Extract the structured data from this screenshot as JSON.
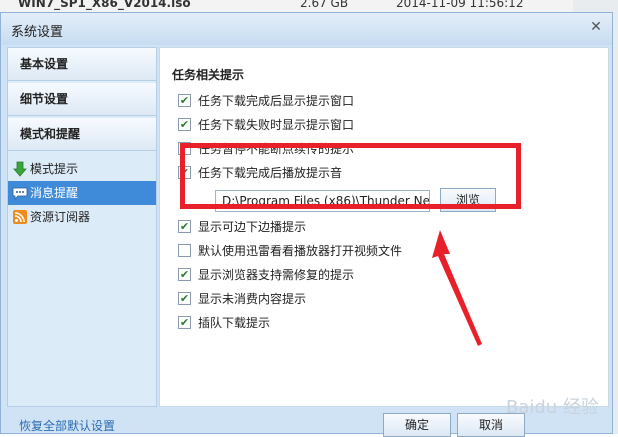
{
  "background": {
    "file_name": "WIN7_SP1_X86_V2014.iso",
    "file_size": "2.67 GB",
    "file_date": "2014-11-09 11:56:12"
  },
  "window": {
    "title": "系统设置",
    "close_glyph": "✕"
  },
  "sidebar": {
    "categories": [
      {
        "label": "基本设置"
      },
      {
        "label": "细节设置"
      },
      {
        "label": "模式和提醒"
      }
    ],
    "items": [
      {
        "label": "模式提示",
        "icon": "green-arrow-down-icon",
        "active": false
      },
      {
        "label": "消息提醒",
        "icon": "message-icon",
        "active": true
      },
      {
        "label": "资源订阅器",
        "icon": "rss-icon",
        "active": false
      }
    ]
  },
  "main": {
    "section_title": "任务相关提示",
    "options": [
      {
        "label": "任务下载完成后显示提示窗口",
        "checked": true
      },
      {
        "label": "任务下载失败时显示提示窗口",
        "checked": true
      },
      {
        "label": "任务暂停不能断点续传的提示",
        "checked": true
      },
      {
        "label": "任务下载完成后播放提示音",
        "checked": true
      },
      {
        "label": "显示可边下边播提示",
        "checked": true
      },
      {
        "label": "默认使用迅雷看看播放器打开视频文件",
        "checked": false
      },
      {
        "label": "显示浏览器支持需修复的提示",
        "checked": true
      },
      {
        "label": "显示未消费内容提示",
        "checked": true
      },
      {
        "label": "插队下载提示",
        "checked": true
      }
    ],
    "sound_path": "D:\\Program Files (x86)\\Thunder Net",
    "browse_label": "浏览"
  },
  "footer": {
    "restore_defaults": "恢复全部默认设置",
    "ok_label": "确定",
    "cancel_label": "取消"
  },
  "watermark": "Baidu 经验",
  "colors": {
    "highlight_red": "#e8202a",
    "active_item": "#3f8ad9",
    "link": "#2d6bb3",
    "check": "#2f7b2f"
  }
}
